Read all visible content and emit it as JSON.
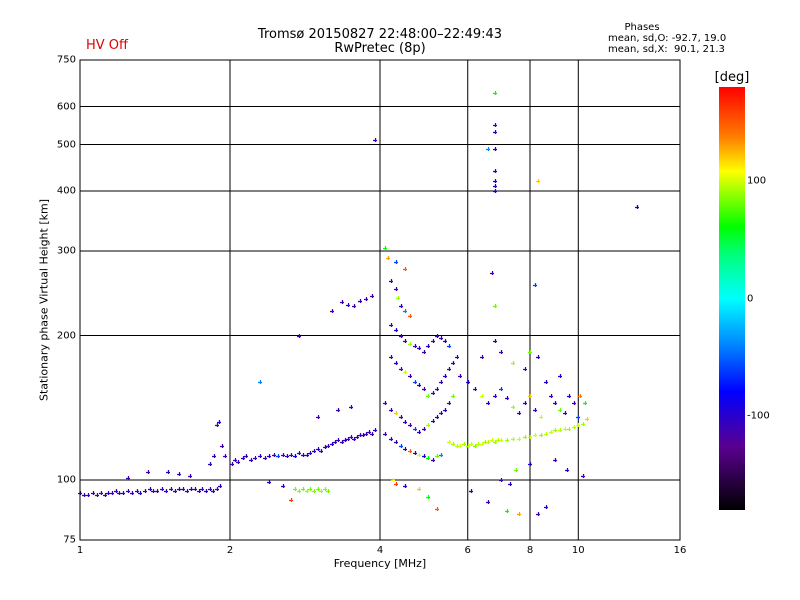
{
  "status_label": "HV Off",
  "chart_data": {
    "type": "scatter",
    "title": "Tromsø 20150827 22:48:00–22:49:43",
    "subtitle": "RwPretec (8p)",
    "xlabel": "Frequency [MHz]",
    "ylabel": "Stationary phase Virtual Height [km]",
    "xscale": "log",
    "yscale": "log",
    "xlim": [
      1,
      16
    ],
    "ylim": [
      75,
      750
    ],
    "xticks": [
      "1",
      "2",
      "4",
      "6",
      "8",
      "10",
      "16"
    ],
    "xtick_values": [
      1,
      2,
      4,
      6,
      8,
      10,
      16
    ],
    "yticks": [
      "75",
      "100",
      "200",
      "300",
      "400",
      "500",
      "600",
      "750"
    ],
    "ytick_values": [
      75,
      100,
      200,
      300,
      400,
      500,
      600,
      750
    ],
    "grid": true,
    "phase_info": {
      "title": "Phases",
      "o_line": "mean, sd,O: -92.7, 19.0",
      "x_line": "mean, sd,X:  90.1, 21.3"
    },
    "colorbar": {
      "label": "[deg]",
      "range": [
        -180,
        180
      ],
      "ticks": [
        "100",
        "0",
        "-100"
      ],
      "tick_values": [
        100,
        0,
        -100
      ]
    },
    "point_format": [
      "frequency_MHz",
      "height_km",
      "phase_deg"
    ],
    "points": [
      [
        1.0,
        94,
        -110
      ],
      [
        1.02,
        93,
        -105
      ],
      [
        1.04,
        93,
        -110
      ],
      [
        1.06,
        94,
        -100
      ],
      [
        1.08,
        93,
        -110
      ],
      [
        1.1,
        94,
        -105
      ],
      [
        1.12,
        93,
        -110
      ],
      [
        1.14,
        94,
        -100
      ],
      [
        1.16,
        94,
        -110
      ],
      [
        1.18,
        95,
        -105
      ],
      [
        1.2,
        94,
        -110
      ],
      [
        1.22,
        94,
        -100
      ],
      [
        1.25,
        95,
        -110
      ],
      [
        1.27,
        94,
        -105
      ],
      [
        1.3,
        95,
        -110
      ],
      [
        1.32,
        94,
        -100
      ],
      [
        1.35,
        95,
        -110
      ],
      [
        1.38,
        96,
        -105
      ],
      [
        1.4,
        95,
        -110
      ],
      [
        1.43,
        95,
        -100
      ],
      [
        1.46,
        96,
        -110
      ],
      [
        1.49,
        95,
        -105
      ],
      [
        1.52,
        96,
        -110
      ],
      [
        1.55,
        95,
        -100
      ],
      [
        1.58,
        96,
        -110
      ],
      [
        1.61,
        96,
        -105
      ],
      [
        1.64,
        95,
        -110
      ],
      [
        1.67,
        96,
        -100
      ],
      [
        1.7,
        96,
        -110
      ],
      [
        1.73,
        95,
        -105
      ],
      [
        1.76,
        96,
        -110
      ],
      [
        1.79,
        95,
        -100
      ],
      [
        1.82,
        96,
        -110
      ],
      [
        1.85,
        95,
        -105
      ],
      [
        1.88,
        96,
        -110
      ],
      [
        1.91,
        97,
        -100
      ],
      [
        1.25,
        101,
        -110
      ],
      [
        1.37,
        104,
        -110
      ],
      [
        1.5,
        104,
        -100
      ],
      [
        1.58,
        103,
        -110
      ],
      [
        1.66,
        102,
        -110
      ],
      [
        1.82,
        108,
        -105
      ],
      [
        1.86,
        112,
        -110
      ],
      [
        1.88,
        130,
        -110
      ],
      [
        1.9,
        132,
        -100
      ],
      [
        1.93,
        118,
        -110
      ],
      [
        1.95,
        112,
        -110
      ],
      [
        2.02,
        108,
        -110
      ],
      [
        2.05,
        110,
        -100
      ],
      [
        2.08,
        109,
        -110
      ],
      [
        2.12,
        111,
        -105
      ],
      [
        2.15,
        112,
        -110
      ],
      [
        2.2,
        110,
        -100
      ],
      [
        2.25,
        111,
        -110
      ],
      [
        2.3,
        112,
        -105
      ],
      [
        2.35,
        111,
        -110
      ],
      [
        2.4,
        112,
        -100
      ],
      [
        2.45,
        113,
        -110
      ],
      [
        2.5,
        112,
        -60
      ],
      [
        2.55,
        113,
        -110
      ],
      [
        2.6,
        112,
        -100
      ],
      [
        2.65,
        113,
        -110
      ],
      [
        2.7,
        112,
        -80
      ],
      [
        2.75,
        114,
        -110
      ],
      [
        2.8,
        113,
        -100
      ],
      [
        2.85,
        113,
        -110
      ],
      [
        2.9,
        114,
        -105
      ],
      [
        2.95,
        115,
        -110
      ],
      [
        3.0,
        116,
        -100
      ],
      [
        3.05,
        115,
        -110
      ],
      [
        3.1,
        117,
        -105
      ],
      [
        3.15,
        118,
        -110
      ],
      [
        3.2,
        119,
        -100
      ],
      [
        3.25,
        120,
        -110
      ],
      [
        3.3,
        121,
        -105
      ],
      [
        3.35,
        120,
        -110
      ],
      [
        3.4,
        121,
        -100
      ],
      [
        3.45,
        122,
        -110
      ],
      [
        3.5,
        123,
        -105
      ],
      [
        3.55,
        122,
        -110
      ],
      [
        3.6,
        123,
        -100
      ],
      [
        3.65,
        124,
        -110
      ],
      [
        3.7,
        124,
        -105
      ],
      [
        3.75,
        125,
        -110
      ],
      [
        3.8,
        126,
        -100
      ],
      [
        3.85,
        125,
        -110
      ],
      [
        3.9,
        127,
        -105
      ],
      [
        2.7,
        96,
        80
      ],
      [
        2.75,
        95,
        85
      ],
      [
        2.8,
        96,
        80
      ],
      [
        2.85,
        95,
        90
      ],
      [
        2.9,
        96,
        80
      ],
      [
        2.95,
        95,
        85
      ],
      [
        3.0,
        96,
        80
      ],
      [
        3.05,
        95,
        90
      ],
      [
        3.1,
        96,
        85
      ],
      [
        3.15,
        95,
        80
      ],
      [
        2.65,
        91,
        160
      ],
      [
        2.55,
        97,
        -110
      ],
      [
        2.4,
        99,
        -100
      ],
      [
        2.75,
        200,
        -110
      ],
      [
        2.3,
        160,
        -40
      ],
      [
        3.2,
        225,
        -110
      ],
      [
        3.35,
        235,
        -110
      ],
      [
        3.45,
        232,
        -105
      ],
      [
        3.55,
        230,
        -110
      ],
      [
        3.65,
        236,
        -100
      ],
      [
        3.75,
        238,
        -110
      ],
      [
        3.85,
        242,
        -110
      ],
      [
        3.9,
        510,
        -110
      ],
      [
        3.0,
        135,
        -110
      ],
      [
        3.3,
        140,
        -110
      ],
      [
        3.5,
        142,
        -100
      ],
      [
        4.1,
        305,
        60
      ],
      [
        4.15,
        290,
        130
      ],
      [
        4.3,
        285,
        -60
      ],
      [
        4.5,
        275,
        150
      ],
      [
        4.2,
        260,
        -100
      ],
      [
        4.3,
        250,
        -110
      ],
      [
        4.35,
        240,
        90
      ],
      [
        4.4,
        230,
        -100
      ],
      [
        4.5,
        225,
        -40
      ],
      [
        4.6,
        220,
        150
      ],
      [
        4.2,
        210,
        -110
      ],
      [
        4.3,
        205,
        -100
      ],
      [
        4.4,
        200,
        -110
      ],
      [
        4.5,
        195,
        -105
      ],
      [
        4.6,
        192,
        90
      ],
      [
        4.7,
        190,
        -110
      ],
      [
        4.8,
        188,
        -100
      ],
      [
        4.9,
        185,
        -110
      ],
      [
        5.0,
        190,
        -100
      ],
      [
        5.1,
        195,
        -110
      ],
      [
        5.2,
        200,
        -105
      ],
      [
        5.3,
        198,
        -110
      ],
      [
        5.4,
        195,
        -100
      ],
      [
        5.5,
        190,
        -60
      ],
      [
        4.2,
        180,
        -110
      ],
      [
        4.3,
        175,
        -100
      ],
      [
        4.4,
        170,
        -110
      ],
      [
        4.5,
        168,
        100
      ],
      [
        4.6,
        165,
        -110
      ],
      [
        4.7,
        160,
        -60
      ],
      [
        4.8,
        158,
        -100
      ],
      [
        4.9,
        155,
        -110
      ],
      [
        5.0,
        150,
        80
      ],
      [
        5.1,
        152,
        -110
      ],
      [
        5.2,
        155,
        -105
      ],
      [
        5.3,
        160,
        -110
      ],
      [
        5.4,
        165,
        -100
      ],
      [
        5.5,
        170,
        -110
      ],
      [
        5.6,
        175,
        -100
      ],
      [
        5.7,
        180,
        -110
      ],
      [
        4.1,
        145,
        -110
      ],
      [
        4.2,
        140,
        -100
      ],
      [
        4.3,
        138,
        120
      ],
      [
        4.4,
        135,
        -110
      ],
      [
        4.5,
        132,
        -100
      ],
      [
        4.6,
        130,
        -110
      ],
      [
        4.7,
        128,
        -60
      ],
      [
        4.8,
        126,
        -100
      ],
      [
        4.9,
        128,
        -110
      ],
      [
        5.0,
        130,
        90
      ],
      [
        5.1,
        133,
        -110
      ],
      [
        5.2,
        135,
        -100
      ],
      [
        5.3,
        138,
        -110
      ],
      [
        5.4,
        140,
        -105
      ],
      [
        5.5,
        145,
        -110
      ],
      [
        5.6,
        150,
        80
      ],
      [
        4.1,
        125,
        -110
      ],
      [
        4.2,
        122,
        -100
      ],
      [
        4.3,
        120,
        -110
      ],
      [
        4.4,
        118,
        -60
      ],
      [
        4.5,
        116,
        -100
      ],
      [
        4.6,
        115,
        150
      ],
      [
        4.7,
        114,
        -110
      ],
      [
        4.8,
        113,
        100
      ],
      [
        4.9,
        112,
        -100
      ],
      [
        5.0,
        111,
        60
      ],
      [
        5.1,
        110,
        -110
      ],
      [
        5.2,
        112,
        80
      ],
      [
        5.3,
        113,
        -40
      ],
      [
        4.25,
        100,
        110
      ],
      [
        4.3,
        98,
        160
      ],
      [
        4.5,
        97,
        -100
      ],
      [
        4.8,
        96,
        120
      ],
      [
        5.5,
        120,
        100
      ],
      [
        5.6,
        119,
        90
      ],
      [
        5.7,
        118,
        95
      ],
      [
        5.8,
        118,
        100
      ],
      [
        5.9,
        119,
        90
      ],
      [
        6.0,
        118,
        95
      ],
      [
        6.1,
        119,
        100
      ],
      [
        6.2,
        118,
        85
      ],
      [
        6.3,
        119,
        95
      ],
      [
        6.4,
        119,
        100
      ],
      [
        6.5,
        120,
        90
      ],
      [
        6.6,
        120,
        95
      ],
      [
        6.7,
        121,
        100
      ],
      [
        6.8,
        120,
        90
      ],
      [
        6.9,
        121,
        95
      ],
      [
        7.0,
        121,
        100
      ],
      [
        7.2,
        121,
        90
      ],
      [
        7.4,
        122,
        95
      ],
      [
        7.6,
        122,
        100
      ],
      [
        7.8,
        123,
        90
      ],
      [
        8.0,
        123,
        95
      ],
      [
        8.2,
        124,
        100
      ],
      [
        8.4,
        124,
        90
      ],
      [
        8.6,
        125,
        95
      ],
      [
        8.8,
        126,
        100
      ],
      [
        9.0,
        127,
        90
      ],
      [
        9.2,
        127,
        95
      ],
      [
        9.4,
        128,
        100
      ],
      [
        9.6,
        128,
        90
      ],
      [
        9.8,
        129,
        95
      ],
      [
        10.0,
        130,
        100
      ],
      [
        10.2,
        131,
        90
      ],
      [
        10.4,
        134,
        120
      ],
      [
        5.8,
        165,
        -110
      ],
      [
        6.0,
        160,
        -100
      ],
      [
        6.2,
        155,
        -110
      ],
      [
        6.4,
        150,
        100
      ],
      [
        6.6,
        145,
        -100
      ],
      [
        6.8,
        150,
        -110
      ],
      [
        7.0,
        155,
        -60
      ],
      [
        7.2,
        148,
        -100
      ],
      [
        7.4,
        142,
        90
      ],
      [
        7.6,
        138,
        -110
      ],
      [
        7.8,
        145,
        -100
      ],
      [
        8.0,
        150,
        120
      ],
      [
        8.2,
        140,
        -110
      ],
      [
        8.4,
        135,
        100
      ],
      [
        8.6,
        160,
        -100
      ],
      [
        8.8,
        150,
        -110
      ],
      [
        9.0,
        145,
        -100
      ],
      [
        9.2,
        140,
        80
      ],
      [
        9.4,
        138,
        -110
      ],
      [
        9.6,
        150,
        -100
      ],
      [
        9.8,
        145,
        -110
      ],
      [
        10.0,
        135,
        -60
      ],
      [
        6.4,
        180,
        -110
      ],
      [
        6.8,
        195,
        -100
      ],
      [
        7.0,
        185,
        -110
      ],
      [
        7.4,
        175,
        90
      ],
      [
        7.8,
        170,
        -110
      ],
      [
        8.0,
        185,
        80
      ],
      [
        8.3,
        180,
        -100
      ],
      [
        9.2,
        165,
        -100
      ],
      [
        10.1,
        150,
        140
      ],
      [
        10.3,
        145,
        60
      ],
      [
        6.1,
        95,
        -100
      ],
      [
        6.6,
        90,
        -110
      ],
      [
        7.0,
        100,
        -110
      ],
      [
        7.3,
        98,
        -100
      ],
      [
        7.5,
        105,
        80
      ],
      [
        8.0,
        108,
        -100
      ],
      [
        8.3,
        85,
        -110
      ],
      [
        9.0,
        110,
        -110
      ],
      [
        9.5,
        105,
        -100
      ],
      [
        10.2,
        102,
        -110
      ],
      [
        7.2,
        86,
        60
      ],
      [
        7.6,
        85,
        130
      ],
      [
        8.6,
        88,
        -100
      ],
      [
        5.2,
        87,
        150
      ],
      [
        5.0,
        92,
        60
      ],
      [
        6.8,
        400,
        -80
      ],
      [
        6.8,
        410,
        -90
      ],
      [
        6.8,
        420,
        -80
      ],
      [
        6.8,
        440,
        -100
      ],
      [
        6.8,
        490,
        -90
      ],
      [
        6.8,
        530,
        -100
      ],
      [
        6.8,
        550,
        -110
      ],
      [
        6.8,
        640,
        60
      ],
      [
        6.7,
        270,
        -110
      ],
      [
        6.6,
        490,
        -40
      ],
      [
        6.8,
        230,
        80
      ],
      [
        8.3,
        420,
        120
      ],
      [
        8.2,
        255,
        -60
      ],
      [
        13.1,
        370,
        -80
      ]
    ]
  }
}
